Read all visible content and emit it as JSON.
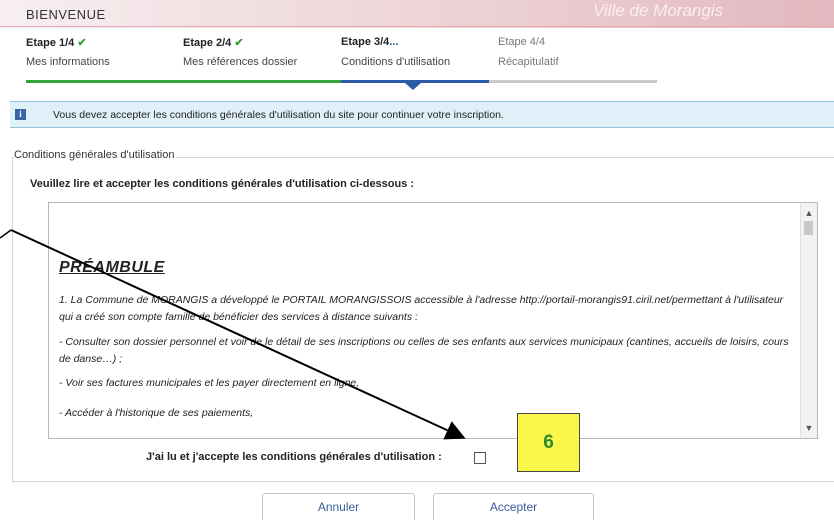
{
  "header": {
    "welcome": "BIENVENUE",
    "city": "Ville de Morangis",
    "colors": {
      "bar": "#ecd2d6",
      "city_text": "#fbeef0"
    }
  },
  "steps": [
    {
      "title": "Etape 1/4",
      "subtitle": "Mes informations",
      "status": "done"
    },
    {
      "title": "Etape 2/4",
      "subtitle": "Mes références dossier",
      "status": "done"
    },
    {
      "title": "Etape 3/4",
      "title_suffix": "...",
      "subtitle": "Conditions d'utilisation",
      "status": "current"
    },
    {
      "title": "Etape 4/4",
      "subtitle": "Récapitulatif",
      "status": "todo"
    }
  ],
  "progress": {
    "done_color": "#36a33c",
    "current_color": "#2b5aa8",
    "todo_color": "#c8c8c8",
    "check_icon": "check-icon"
  },
  "info": {
    "icon": "info-icon",
    "message": "Vous devez accepter les conditions générales d'utilisation du site pour continuer votre inscription."
  },
  "cgu": {
    "legend": "Conditions générales d'utilisation",
    "instruction": "Veuillez lire et accepter les conditions générales d'utilisation ci-dessous :",
    "heading": "PRÉAMBULE",
    "paragraphs": [
      "1. La Commune de MORANGIS  a développé le PORTAIL MORANGISSOIS  accessible à l'adresse http://portail-morangis91.ciril.net/permettant à l'utilisateur qui a créé son compte famille de bénéficier des services à distance suivants :",
      "- Consulter son dossier personnel et voir de le détail de ses inscriptions ou celles de ses enfants aux services municipaux (cantines, accueils de loisirs, cours de danse…) ;",
      "- Voir ses factures municipales et les payer directement en ligne,",
      "- Accéder à l'historique de ses paiements,"
    ],
    "accept_label": "J'ai lu et j'accepte les conditions générales d'utilisation :",
    "accept_checked": false
  },
  "callout": {
    "number": "6",
    "color": "#fbf64a"
  },
  "buttons": {
    "cancel": "Annuler",
    "accept": "Accepter"
  }
}
